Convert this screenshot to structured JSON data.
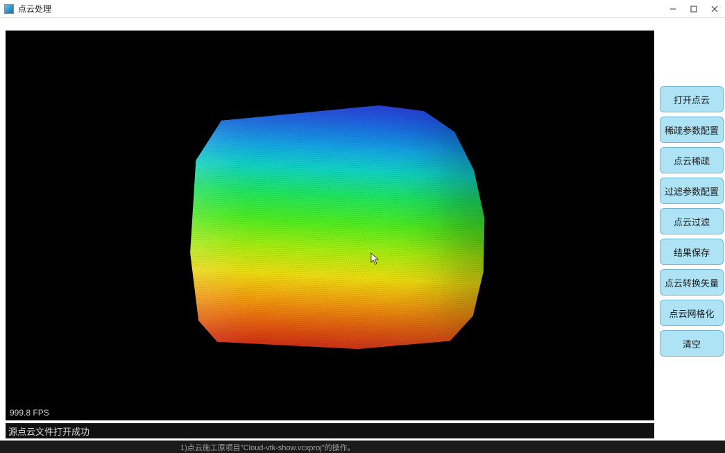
{
  "window": {
    "title": "点云处理"
  },
  "viewport": {
    "fps_label": "999.8 FPS"
  },
  "status": {
    "message": "源点云文件打开成功"
  },
  "bottom": {
    "hint": "1)点云施工原项目\"Cloud-vtk-show.vcxproj\"的操作。"
  },
  "buttons": {
    "open": "打开点云",
    "sparse_config": "稀疏参数配置",
    "sparse": "点云稀疏",
    "filter_config": "过滤参数配置",
    "filter": "点云过滤",
    "save": "结果保存",
    "transform": "点云转换矢量",
    "mesh": "点云网格化",
    "clear": "清空"
  }
}
